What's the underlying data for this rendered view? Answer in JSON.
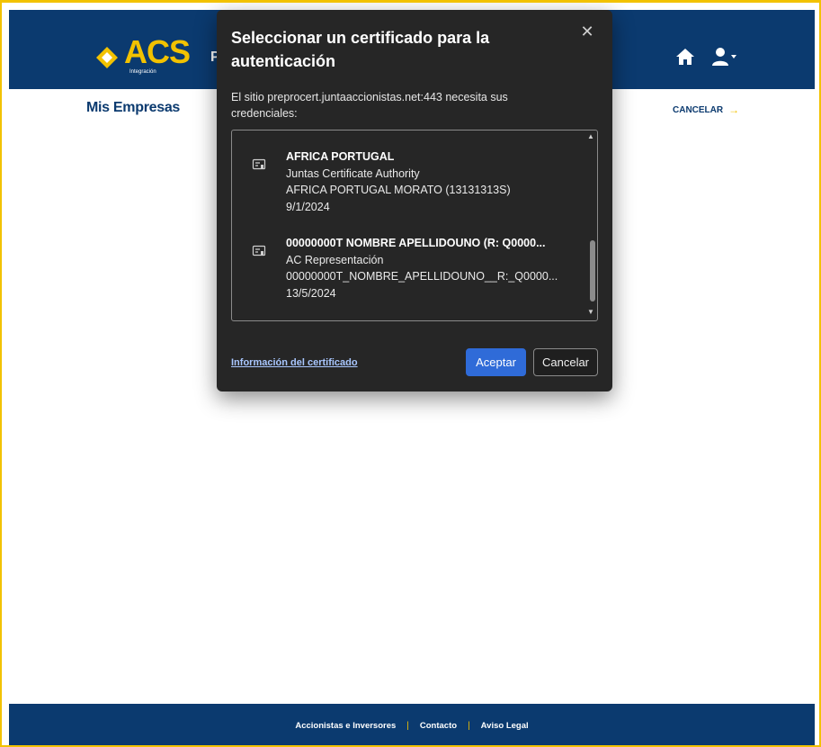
{
  "header": {
    "logo_text": "ACS",
    "logo_subtitle": "Integración",
    "brand_trail": "Pl",
    "home_icon": "home-icon",
    "user_icon": "user-menu-icon"
  },
  "page": {
    "title": "Mis Empresas",
    "cancel_label": "CANCELAR",
    "cancel_arrow": "→"
  },
  "dialog": {
    "title": "Seleccionar un certificado para la autenticación",
    "close_symbol": "✕",
    "description": "El sitio preprocert.juntaaccionistas.net:443 necesita sus credenciales:",
    "certificates": [
      {
        "name": "AFRICA PORTUGAL",
        "issuer": "Juntas Certificate Authority",
        "subject": "AFRICA PORTUGAL MORATO (13131313S)",
        "date": "9/1/2024"
      },
      {
        "name": "00000000T NOMBRE APELLIDOUNO (R: Q0000...",
        "issuer": "AC Representación",
        "subject": "00000000T_NOMBRE_APELLIDOUNO__R:_Q0000...",
        "date": "13/5/2024"
      }
    ],
    "cert_info_link": "Información del certificado",
    "accept_label": "Aceptar",
    "cancel_label": "Cancelar"
  },
  "footer": {
    "links": [
      "Accionistas e Inversores",
      "Contacto",
      "Aviso Legal"
    ],
    "separator": "|"
  },
  "colors": {
    "brand_blue": "#0b3a6f",
    "brand_yellow": "#f2c200",
    "dialog_bg": "#262626",
    "accept_blue": "#2f6bd8",
    "link_blue": "#a9c7ff"
  }
}
